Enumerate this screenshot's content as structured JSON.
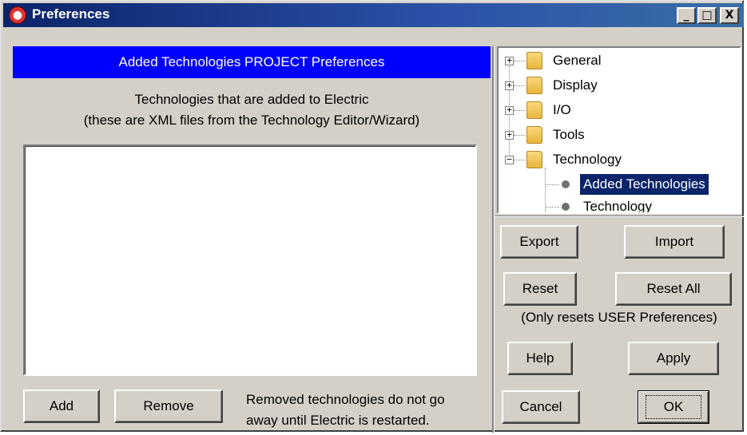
{
  "window": {
    "title": "Preferences",
    "controls": {
      "minimize": "_",
      "maximize": "□",
      "close": "X"
    }
  },
  "left": {
    "banner": "Added Technologies PROJECT Preferences",
    "description_line1": "Technologies that are added to Electric",
    "description_line2": "(these are XML files from the Technology Editor/Wizard)",
    "add_label": "Add",
    "remove_label": "Remove",
    "note_line1": "Removed technologies do not go",
    "note_line2": "away until Electric is restarted."
  },
  "tree": {
    "items": [
      {
        "label": "General",
        "expanded": false
      },
      {
        "label": "Display",
        "expanded": false
      },
      {
        "label": "I/O",
        "expanded": false
      },
      {
        "label": "Tools",
        "expanded": false
      },
      {
        "label": "Technology",
        "expanded": true
      }
    ],
    "children": [
      {
        "label": "Added Technologies",
        "selected": true
      },
      {
        "label": "Technology",
        "selected": false
      }
    ],
    "expand_symbol": "+",
    "collapse_symbol": "−"
  },
  "right": {
    "export_label": "Export",
    "import_label": "Import",
    "reset_label": "Reset",
    "reset_all_label": "Reset All",
    "reset_note": "(Only resets USER Preferences)",
    "help_label": "Help",
    "apply_label": "Apply",
    "cancel_label": "Cancel",
    "ok_label": "OK"
  },
  "colors": {
    "banner": "#0000ff",
    "selection": "#0a246a",
    "face": "#d4d0c8"
  }
}
